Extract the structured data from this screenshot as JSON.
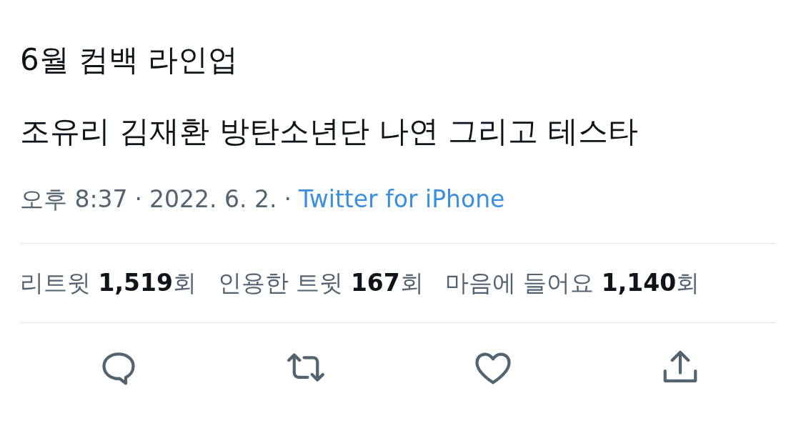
{
  "tweet": {
    "lines": [
      "6월 컴백 라인업",
      "조유리 김재환 방탄소년단 나연 그리고 테스타"
    ]
  },
  "meta": {
    "time": "오후 8:37",
    "separator_1": "·",
    "date": "2022. 6. 2.",
    "separator_2": "·",
    "source": "Twitter for iPhone"
  },
  "stats": [
    {
      "text": "리트윗 **1,519**회"
    },
    {
      "text": "인용한 트윗 **167**회"
    },
    {
      "text": "마음에 들어요 **1,140**회"
    }
  ],
  "actions": [
    {
      "kind": "reply"
    },
    {
      "kind": "retweet"
    },
    {
      "kind": "like"
    },
    {
      "kind": "share"
    }
  ]
}
